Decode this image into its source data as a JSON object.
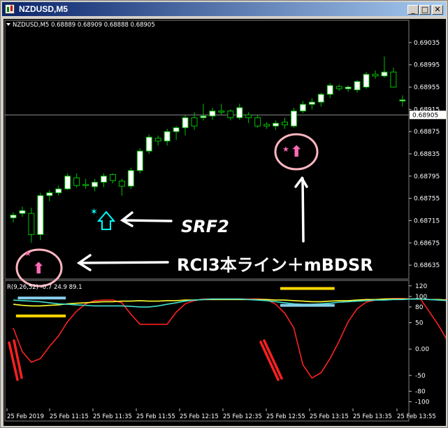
{
  "window": {
    "title": "NZDUSD,M5",
    "minimize": "_",
    "restore": "□",
    "close": "✕"
  },
  "chart_data": [
    {
      "type": "candlestick",
      "symbol_header": "NZDUSD,M5  0.68889 0.68909 0.68888 0.68905",
      "current_price": "0.68905",
      "y_tick_labels": [
        "0.69035",
        "0.68995",
        "0.68955",
        "0.68915",
        "0.68875",
        "0.68835",
        "0.68795",
        "0.68755",
        "0.68715",
        "0.68675",
        "0.68635"
      ],
      "ylim": [
        0.6861,
        0.6906
      ],
      "x_tick_labels": [
        "25 Feb 2019",
        "25 Feb 11:15",
        "25 Feb 11:35",
        "25 Feb 11:55",
        "25 Feb 12:15",
        "25 Feb 12:35",
        "25 Feb 12:55",
        "25 Feb 13:15",
        "25 Feb 13:35",
        "25 Feb 13:55"
      ],
      "candles_ohlc": [
        [
          0.6872,
          0.6873,
          0.68712,
          0.68725
        ],
        [
          0.68728,
          0.6874,
          0.68722,
          0.68733
        ],
        [
          0.68728,
          0.68738,
          0.68675,
          0.6869
        ],
        [
          0.6869,
          0.68765,
          0.6868,
          0.6876
        ],
        [
          0.6876,
          0.6877,
          0.6875,
          0.68765
        ],
        [
          0.68765,
          0.68778,
          0.6876,
          0.68772
        ],
        [
          0.68772,
          0.688,
          0.6877,
          0.68795
        ],
        [
          0.68792,
          0.688,
          0.68774,
          0.68778
        ],
        [
          0.6878,
          0.6879,
          0.68772,
          0.68778
        ],
        [
          0.68776,
          0.6879,
          0.68768,
          0.68784
        ],
        [
          0.68784,
          0.688,
          0.68775,
          0.68795
        ],
        [
          0.68798,
          0.688,
          0.68782,
          0.68787
        ],
        [
          0.68786,
          0.6879,
          0.6876,
          0.68777
        ],
        [
          0.68777,
          0.6881,
          0.68772,
          0.68805
        ],
        [
          0.68805,
          0.68845,
          0.688,
          0.6884
        ],
        [
          0.6884,
          0.6887,
          0.68835,
          0.68865
        ],
        [
          0.68863,
          0.68868,
          0.6885,
          0.68858
        ],
        [
          0.68858,
          0.6888,
          0.6885,
          0.68875
        ],
        [
          0.68875,
          0.68885,
          0.6886,
          0.68882
        ],
        [
          0.68882,
          0.68905,
          0.68868,
          0.689
        ],
        [
          0.689,
          0.6891,
          0.68878,
          0.68885
        ],
        [
          0.689,
          0.68925,
          0.68895,
          0.68903
        ],
        [
          0.68903,
          0.68918,
          0.68896,
          0.68912
        ],
        [
          0.68912,
          0.68925,
          0.68905,
          0.6891
        ],
        [
          0.68912,
          0.68915,
          0.68895,
          0.689
        ],
        [
          0.689,
          0.68925,
          0.68896,
          0.68918
        ],
        [
          0.68905,
          0.6891,
          0.6889,
          0.689
        ],
        [
          0.689,
          0.68905,
          0.68882,
          0.68885
        ],
        [
          0.68888,
          0.68892,
          0.6888,
          0.68885
        ],
        [
          0.68885,
          0.68895,
          0.68878,
          0.6889
        ],
        [
          0.68892,
          0.689,
          0.6888,
          0.68887
        ],
        [
          0.68885,
          0.68918,
          0.68882,
          0.68912
        ],
        [
          0.68912,
          0.6893,
          0.68908,
          0.68924
        ],
        [
          0.68924,
          0.68935,
          0.68915,
          0.68928
        ],
        [
          0.68928,
          0.68945,
          0.6892,
          0.68942
        ],
        [
          0.68942,
          0.68962,
          0.68935,
          0.68958
        ],
        [
          0.68956,
          0.6896,
          0.68948,
          0.68952
        ],
        [
          0.68952,
          0.68958,
          0.68946,
          0.68955
        ],
        [
          0.6895,
          0.68968,
          0.68945,
          0.68965
        ],
        [
          0.68955,
          0.68982,
          0.68952,
          0.68978
        ],
        [
          0.68978,
          0.68985,
          0.6897,
          0.68975
        ],
        [
          0.68975,
          0.6901,
          0.68972,
          0.68982
        ],
        [
          0.68982,
          0.6899,
          0.68955,
          0.68955
        ],
        [
          0.6893,
          0.6894,
          0.6892,
          0.68932
        ]
      ],
      "annotations": {
        "srf2": "SRF2",
        "rci": "RCI3本ライン＋mBDSR"
      },
      "marker_symbols": {
        "up_arrow": "⬆",
        "star": "★",
        "asterisk": "✶"
      }
    },
    {
      "type": "line",
      "indicator_label": "R(9,26,52) -0.7 24.9 89.1",
      "y_tick_labels": [
        "120",
        "100",
        "80",
        "50",
        "0.00",
        "-50",
        "-80",
        "-100"
      ],
      "y_tick_values": [
        120,
        100,
        80,
        50,
        0,
        -50,
        -80,
        -100
      ],
      "ylim": [
        -110,
        125
      ],
      "series": [
        {
          "color": "#ff2020",
          "values": [
            40,
            -5,
            -25,
            -18,
            5,
            25,
            52,
            72,
            86,
            92,
            93,
            93,
            88,
            66,
            47,
            47,
            47,
            47,
            70,
            86,
            92,
            95,
            95,
            95,
            95,
            95,
            95,
            95,
            94,
            85,
            68,
            40,
            -30,
            -55,
            -45,
            -18,
            15,
            52,
            77,
            89,
            93,
            95,
            96,
            96,
            95,
            95,
            70,
            45,
            15
          ]
        },
        {
          "color": "#ffff30",
          "values": [
            85,
            83,
            82,
            82,
            83,
            84,
            86,
            87,
            88,
            89,
            90,
            90,
            91,
            91,
            92,
            91,
            91,
            92,
            92,
            93,
            93,
            94,
            94,
            94,
            94,
            94,
            94,
            94,
            94,
            93,
            93,
            92,
            91,
            90,
            90,
            91,
            92,
            92,
            93,
            94,
            94,
            95,
            95,
            95,
            95,
            95,
            94,
            94,
            93
          ]
        },
        {
          "color": "#40e0d0",
          "values": [
            93,
            92,
            91,
            90,
            88,
            86,
            85,
            84,
            83,
            82,
            82,
            82,
            82,
            81,
            80,
            80,
            82,
            85,
            88,
            91,
            93,
            94,
            95,
            95,
            95,
            95,
            94,
            93,
            92,
            90,
            88,
            86,
            85,
            85,
            86,
            87,
            89,
            90,
            91,
            92,
            93,
            93,
            94,
            94,
            95,
            95,
            94,
            93,
            92
          ]
        }
      ],
      "signal_bars": [
        {
          "color": "#87ceeb",
          "y": 97,
          "x": [
            0.5,
            5.8
          ]
        },
        {
          "color": "#ffd700",
          "y": 63,
          "x": [
            0.3,
            5.8
          ]
        },
        {
          "color": "#ffd700",
          "y": 115,
          "x": [
            29.5,
            35.5
          ]
        },
        {
          "color": "#87ceeb",
          "y": 83,
          "x": [
            29.5,
            35.5
          ]
        }
      ]
    }
  ],
  "colors": {
    "background": "#000000",
    "grid": "#404040",
    "axis_text": "#ffffff",
    "bull_body": "#ffffff",
    "bull_wick": "#00c000",
    "bear_body": "#000000",
    "annotation": "#ffffff",
    "pink_arrow": "#ff69b4",
    "pink_circle": "#ffb6c1",
    "cyan_arrow": "#00ffff",
    "rci_red": "#ff2020"
  }
}
